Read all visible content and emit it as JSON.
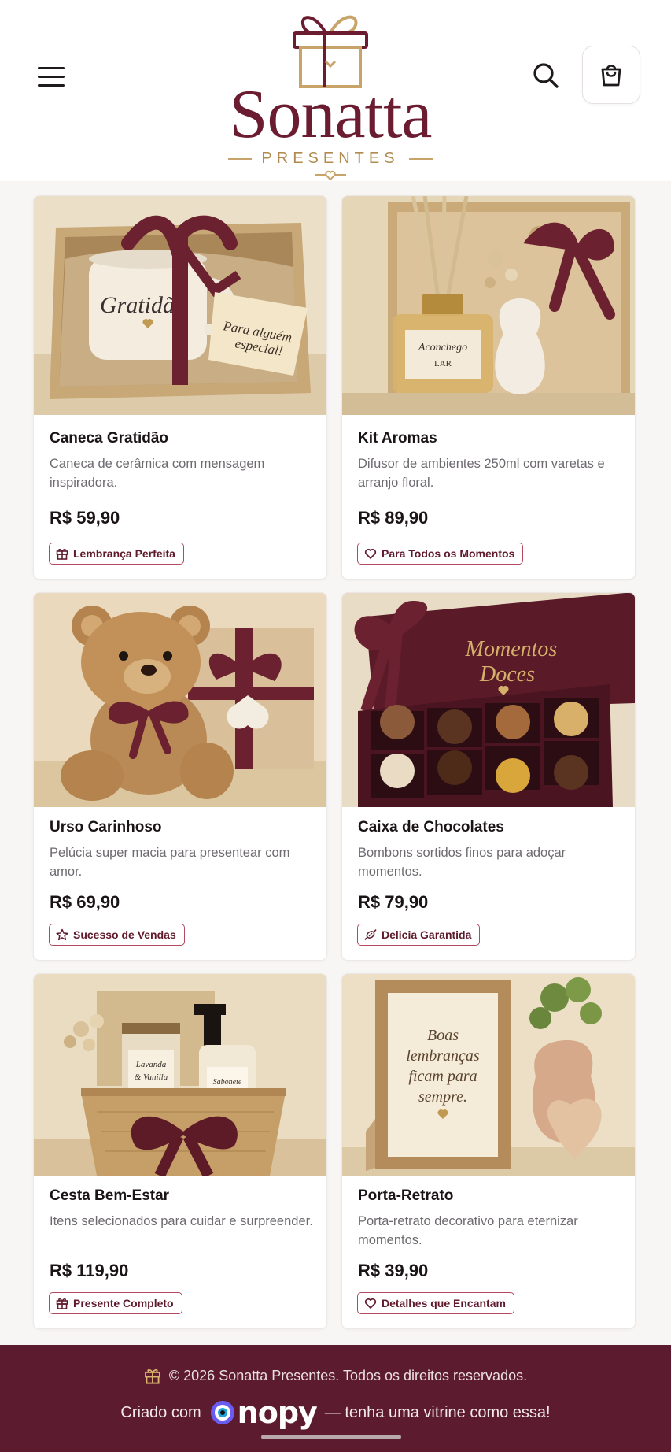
{
  "header": {
    "brand_name": "Sonatta",
    "brand_subtitle": "PRESENTES",
    "menu_icon": "hamburger-menu-icon",
    "search_icon": "search-icon",
    "cart_icon": "shopping-bag-icon"
  },
  "products": [
    {
      "title": "Caneca Gratidão",
      "description": "Caneca de cerâmica com mensagem inspiradora.",
      "price": "R$ 59,90",
      "badge": "Lembrança Perfeita",
      "badge_icon": "gift-icon",
      "image_text_1": "Gratidão",
      "image_text_2": "Para alguém especial!"
    },
    {
      "title": "Kit Aromas",
      "description": "Difusor de ambientes 250ml com varetas e arranjo floral.",
      "price": "R$ 89,90",
      "badge": "Para Todos os Momentos",
      "badge_icon": "heart-icon",
      "image_text_1": "Aconchego",
      "image_text_2": "LAR"
    },
    {
      "title": "Urso Carinhoso",
      "description": "Pelúcia super macia para presentear com amor.",
      "price": "R$ 69,90",
      "badge": "Sucesso de Vendas",
      "badge_icon": "star-icon"
    },
    {
      "title": "Caixa de Chocolates",
      "description": "Bombons sortidos finos para adoçar momentos.",
      "price": "R$ 79,90",
      "badge": "Delicia Garantida",
      "badge_icon": "candy-icon",
      "image_text_1": "Momentos",
      "image_text_2": "Doces"
    },
    {
      "title": "Cesta Bem-Estar",
      "description": "Itens selecionados para cuidar e surpreender.",
      "price": "R$ 119,90",
      "badge": "Presente Completo",
      "badge_icon": "gift-icon",
      "image_text_1": "Lavanda & Vanilla",
      "image_text_2": "Sabonete Líquido"
    },
    {
      "title": "Porta-Retrato",
      "description": "Porta-retrato decorativo para eternizar momentos.",
      "price": "R$ 39,90",
      "badge": "Detalhes que Encantam",
      "badge_icon": "heart-icon",
      "image_text_1": "Boas lembranças ficam para sempre."
    }
  ],
  "footer": {
    "copyright": "© 2026 Sonatta Presentes. Todos os direitos reservados.",
    "credit_prefix": "Criado com",
    "credit_brand": "nopy",
    "credit_suffix": "— tenha uma vitrine como essa!"
  },
  "colors": {
    "brand": "#6b1c30",
    "gold": "#b08a4e",
    "footer_bg": "#5c1b2e",
    "badge_border": "#b2495f"
  }
}
